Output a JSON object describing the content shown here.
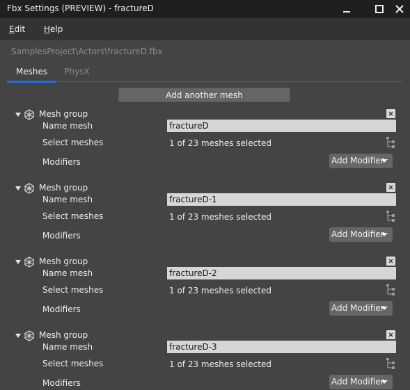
{
  "window": {
    "title": "Fbx Settings (PREVIEW) - fractureD",
    "controls": [
      "minimize-icon",
      "maximize-icon",
      "close-icon"
    ]
  },
  "menu": {
    "items": [
      {
        "label": "Edit",
        "mnemonic": "E",
        "rest": "dit"
      },
      {
        "label": "Help",
        "mnemonic": "H",
        "rest": "elp"
      }
    ]
  },
  "file_path": "SamplesProject\\Actors\\fractureD.fbx",
  "tabs": [
    {
      "label": "Meshes",
      "active": true
    },
    {
      "label": "PhysX",
      "active": false
    }
  ],
  "add_mesh_label": "Add another mesh",
  "labels": {
    "mesh_group": "Mesh group",
    "name_mesh": "Name mesh",
    "select_meshes": "Select meshes",
    "modifiers": "Modifiers",
    "add_modifier": "Add Modifier"
  },
  "groups": [
    {
      "name": "fractureD",
      "selection": "1 of 23 meshes selected"
    },
    {
      "name": "fractureD-1",
      "selection": "1 of 23 meshes selected"
    },
    {
      "name": "fractureD-2",
      "selection": "1 of 23 meshes selected"
    },
    {
      "name": "fractureD-3",
      "selection": "1 of 23 meshes selected"
    }
  ],
  "colors": {
    "background": "#444444",
    "titlebar": "#1f1f1f",
    "tab_accent": "#1e70eb",
    "input_bg": "#d6d6d6"
  }
}
